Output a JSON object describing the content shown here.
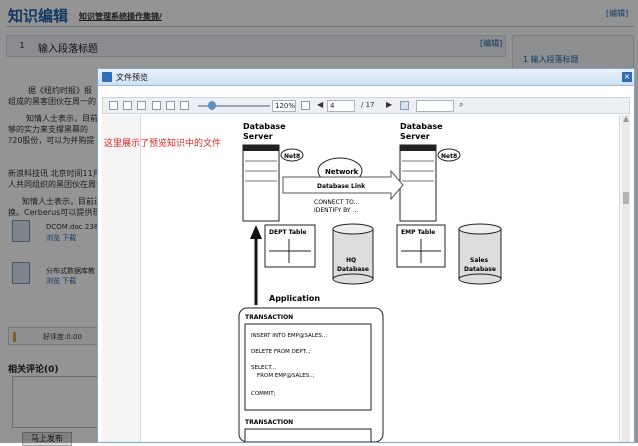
{
  "page": {
    "title": "知识编辑",
    "breadcrumb": "知识管理系统操作集锦/",
    "edit_link_top": "[编辑]"
  },
  "section": {
    "number": "1",
    "title": "输入段落标题",
    "edit_link": "[编辑]"
  },
  "toc": {
    "item": "1 输入段落标题"
  },
  "background_text": {
    "line1": "据《纽约时报》报",
    "line2": "组成的黑客团伙在周一的",
    "line3": "知情人士表示，目前",
    "line4": "够的实力来支撑黑幕的",
    "line5": "?20股份，可以为并购提",
    "line6": "新浪科技讯 北京时间11月2",
    "line7": "人共同组织的黑团伙在周一",
    "line8": "知情人士表示，目前还",
    "line9": "换。Cerberus可以提供现金"
  },
  "attachments": [
    {
      "name": "DCOM.doc",
      "size": "238",
      "links": "浏览  下载"
    },
    {
      "name": "分布式数据库教",
      "size": "",
      "links": "浏览  下载"
    }
  ],
  "rating": {
    "label": "好评度:0.00",
    "extra": "日"
  },
  "comments": {
    "title": "相关评论(0)",
    "publish_button": "马上发布"
  },
  "dialog": {
    "title": "文件预览",
    "close": "×",
    "toolbar": {
      "zoom": "120%",
      "page": "4",
      "total": "/ 17",
      "search_value": ""
    },
    "preview_note": "这里展示了预览知识中的文件",
    "diagram": {
      "server_left_label": "Database",
      "server_left_label2": "Server",
      "server_right_label": "Database",
      "server_right_label2": "Server",
      "net8_left": "Net8",
      "net8_right": "Net8",
      "network": "Network",
      "db_link": "Database Link",
      "connect_to": "CONNECT TO...",
      "identify_by": "IDENTIFY BY ...",
      "dept_table": "DEPT Table",
      "emp_table": "EMP Table",
      "hq_db_1": "HQ",
      "hq_db_2": "Database",
      "sales_db_1": "Sales",
      "sales_db_2": "Database",
      "application": "Application",
      "transaction1": "TRANSACTION",
      "sql1": "INSERT INTO EMP@SALES..;",
      "sql2": "DELETE FROM DEPT..;",
      "sql3": "SELECT...",
      "sql4": "FROM EMP@SALES..;",
      "sql5": "COMMIT;",
      "transaction2": "TRANSACTION"
    }
  }
}
